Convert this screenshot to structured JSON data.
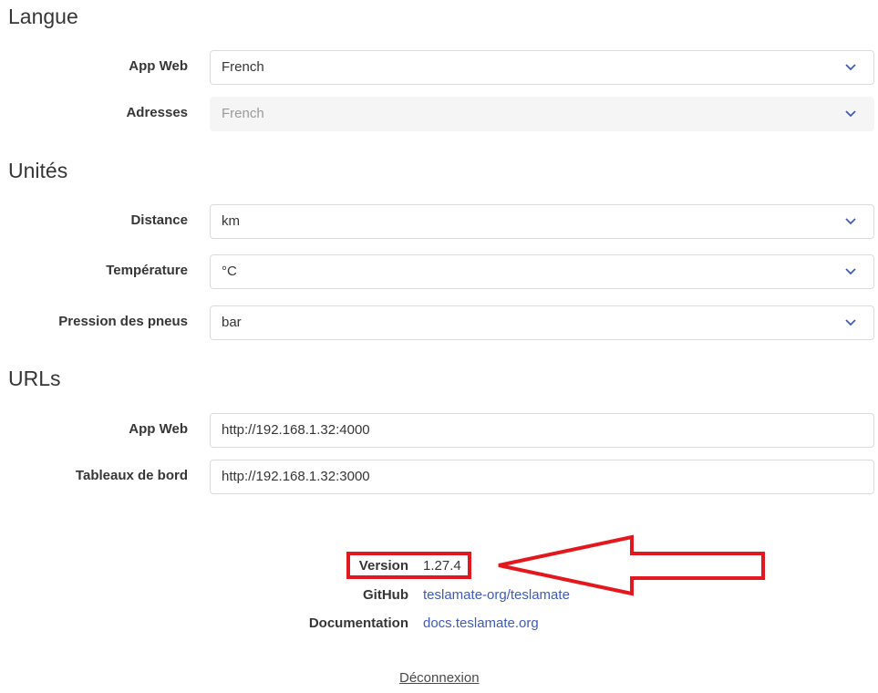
{
  "sections": {
    "language": {
      "title": "Langue",
      "webapp": {
        "label": "App Web",
        "value": "French"
      },
      "addresses": {
        "label": "Adresses",
        "value": "French"
      }
    },
    "units": {
      "title": "Unités",
      "distance": {
        "label": "Distance",
        "value": "km"
      },
      "temperature": {
        "label": "Température",
        "value": "°C"
      },
      "tire_pressure": {
        "label": "Pression des pneus",
        "value": "bar"
      }
    },
    "urls": {
      "title": "URLs",
      "webapp": {
        "label": "App Web",
        "value": "http://192.168.1.32:4000"
      },
      "dashboards": {
        "label": "Tableaux de bord",
        "value": "http://192.168.1.32:3000"
      }
    }
  },
  "info": {
    "version": {
      "label": "Version",
      "value": "1.27.4"
    },
    "github": {
      "label": "GitHub",
      "value": "teslamate-org/teslamate"
    },
    "documentation": {
      "label": "Documentation",
      "value": "docs.teslamate.org"
    }
  },
  "logout_label": "Déconnexion",
  "colors": {
    "accent": "#3e5cb8",
    "annotation": "#e3181f"
  },
  "icons": {
    "select": "chevron-down-icon"
  }
}
